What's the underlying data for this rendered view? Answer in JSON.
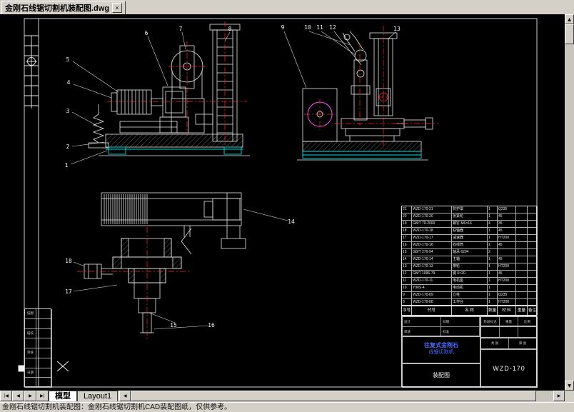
{
  "window": {
    "tab_title": "金刚石线锯切割机装配图.dwg",
    "close": "×"
  },
  "nav": {
    "first": "|◀",
    "prev": "◀",
    "next": "▶",
    "last": "▶|"
  },
  "tabs": {
    "model": "模型",
    "layout1": "Layout1"
  },
  "scrollbar": {
    "up": "▲",
    "down": "▼",
    "left": "◀",
    "right": "▶"
  },
  "status": {
    "text": "金刚石线锯切割机装配图：金刚石线锯切割机CAD装配图纸，仅供参考。"
  },
  "callouts": [
    "1",
    "2",
    "3",
    "4",
    "5",
    "6",
    "7",
    "8",
    "9",
    "10",
    "11",
    "12",
    "13",
    "14",
    "15",
    "16",
    "17",
    "18"
  ],
  "title_block": {
    "header": [
      "序号",
      "代号",
      "名 称",
      "数量",
      "材 料",
      "重量",
      "备注"
    ],
    "rows": [
      [
        "21",
        "WZD-170-21",
        "防护罩",
        "1",
        "Q235",
        "",
        ""
      ],
      [
        "20",
        "WZD-170-20",
        "张紧轮",
        "1",
        "45",
        "",
        ""
      ],
      [
        "19",
        "GB/T 70-2000",
        "螺钉 M6×16",
        "4",
        "35",
        "",
        ""
      ],
      [
        "18",
        "WZD-170-18",
        "联轴器",
        "1",
        "45",
        "",
        ""
      ],
      [
        "17",
        "WZD-170-17",
        "减速器",
        "1",
        "HT200",
        "",
        ""
      ],
      [
        "16",
        "WZD-170-16",
        "收线筒",
        "1",
        "45",
        "",
        ""
      ],
      [
        "15",
        "GB/T 276-94",
        "轴承 6204",
        "2",
        "",
        "",
        ""
      ],
      [
        "14",
        "WZD-170-14",
        "主轴",
        "1",
        "45",
        "",
        ""
      ],
      [
        "13",
        "WZD-170-13",
        "带轮",
        "1",
        "HT200",
        "",
        ""
      ],
      [
        "12",
        "GB/T 1096-79",
        "键 6×20",
        "1",
        "45",
        "",
        ""
      ],
      [
        "11",
        "WZD-170-11",
        "电机座",
        "1",
        "HT200",
        "",
        ""
      ],
      [
        "10",
        "Y90S-4",
        "电动机",
        "1",
        "",
        "",
        ""
      ],
      [
        "9",
        "WZD-170-09",
        "立柱",
        "1",
        "Q235",
        "",
        ""
      ],
      [
        "8",
        "WZD-170-08",
        "工作台",
        "1",
        "HT200",
        "",
        ""
      ]
    ],
    "sign_labels": [
      "设计",
      "日期",
      "审核",
      "批准"
    ],
    "title_line1": "往复式金刚石",
    "title_line2": "线锯切割机",
    "doc_type": "装配图",
    "stage_labels": [
      "阶段标记",
      "重量",
      "比例"
    ],
    "sheet_labels": [
      "共 张",
      "第 张"
    ],
    "drawing_no": "WZD-170"
  },
  "side_table": {
    "labels": [
      "描图",
      "描校",
      "审核",
      "日期"
    ]
  },
  "colors": {
    "accent_blue": "#4a6bff",
    "line_red": "#ff2b2b",
    "line_cyan": "#00e0e0",
    "line_magenta": "#ff50ff"
  }
}
